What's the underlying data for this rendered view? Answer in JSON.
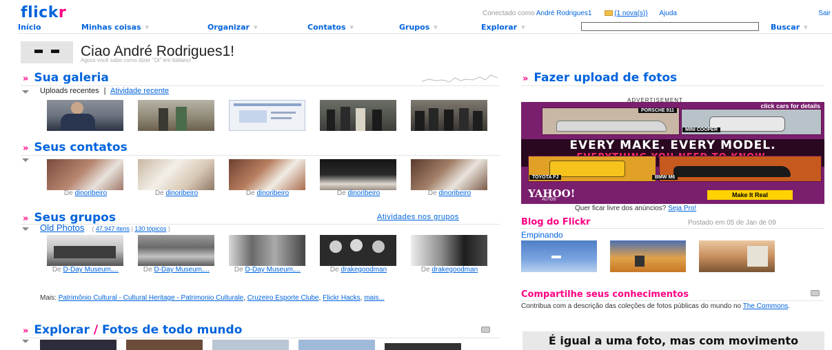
{
  "header": {
    "logo_flick": "flick",
    "logo_r": "r",
    "logged_in_prefix": "Conectado como",
    "username": "André Rodrigues1",
    "new_messages": "(1 nova(s))",
    "help": "Ajuda",
    "exit": "Sair"
  },
  "nav": {
    "home": "Início",
    "my_stuff": "Minhas coisas",
    "organize": "Organizar",
    "contacts": "Contatos",
    "groups": "Grupos",
    "explore": "Explorar",
    "search_value": "",
    "search_button": "Buscar"
  },
  "greeting": {
    "title": "Ciao André Rodrigues1!",
    "subtitle": "Agora você sabe como dizer \"Oi\" em italiano!"
  },
  "gallery": {
    "title": "Sua galeria",
    "tab_uploads": "Uploads recentes",
    "tab_separator": "|",
    "tab_activity": "Atividade recente"
  },
  "contacts": {
    "title": "Seus contatos",
    "from": "De",
    "items": [
      {
        "user": "dinoribeiro"
      },
      {
        "user": "dinoribeiro"
      },
      {
        "user": "dinoribeiro"
      },
      {
        "user": "dinoribeiro"
      },
      {
        "user": "dinoribeiro"
      }
    ]
  },
  "groups": {
    "title": "Seus grupos",
    "activity_link": "Atividades nos grupos",
    "group_name": "Old Photos",
    "stats_open": "(",
    "items_count": "47.947 itens",
    "stats_sep": "|",
    "topics_count": "130 tópicos",
    "stats_close": ")",
    "from": "De",
    "photos": [
      {
        "user": "D-Day Museum,..."
      },
      {
        "user": "D-Day Museum,..."
      },
      {
        "user": "D-Day Museum,..."
      },
      {
        "user": "drakegoodman"
      },
      {
        "user": "drakegoodman"
      }
    ],
    "more_label": "Mais:",
    "more_links": [
      "Patrimônio Cultural - Cultural Heritage - Patrimonio Culturale",
      "Cruzeiro Esporte Clube",
      "Flickr Hacks",
      "mais..."
    ]
  },
  "explore": {
    "title_a": "Explorar",
    "slash": "/",
    "title_b": "Fotos de todo mundo"
  },
  "upload": {
    "title": "Fazer upload de fotos"
  },
  "advert": {
    "label": "ADVERTISEMENT",
    "click_cars": "click cars for details",
    "car1": "PORSCHE 911",
    "car2": "MINI COOPER",
    "line1": "EVERY MAKE. EVERY MODEL.",
    "line2": "EVERYTHING YOU NEED TO KNOW.",
    "car3": "TOYOTA FJ",
    "car4": "BMW M6",
    "brand": "YAHOO!",
    "brand_sub": "AUTOS",
    "cta": "Make It Real",
    "free_prefix": "Quer ficar livre dos anúncios?",
    "free_link": "Seja Pro!"
  },
  "blog": {
    "title": "Blog do Flickr",
    "date": "Postado em 05 de Jan de 09",
    "post": "Empinando"
  },
  "share": {
    "title": "Compartilhe seus conhecimentos",
    "text_a": "Contribua com a descrição das coleções de fotos públicas do mundo no",
    "link": "The Commons",
    "text_b": "."
  },
  "promo": {
    "text": "É igual a uma foto, mas com movimento"
  },
  "colors": {
    "flickr_blue": "#0063dc",
    "flickr_pink": "#ff0084"
  }
}
